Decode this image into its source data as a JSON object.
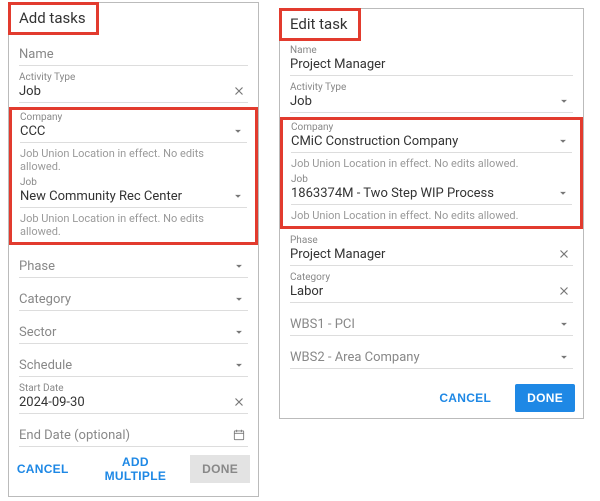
{
  "left": {
    "title": "Add tasks",
    "name": {
      "label": "Name",
      "value": ""
    },
    "activity_type": {
      "label": "Activity Type",
      "value": "Job"
    },
    "locked": {
      "company": {
        "label": "Company",
        "value": "CCC"
      },
      "msg1": "Job Union Location in effect. No edits allowed.",
      "job": {
        "label": "Job",
        "value": "New Community Rec Center"
      },
      "msg2": "Job Union Location in effect. No edits allowed."
    },
    "phase": {
      "label": "Phase"
    },
    "category": {
      "label": "Category"
    },
    "sector": {
      "label": "Sector"
    },
    "schedule": {
      "label": "Schedule"
    },
    "start_date": {
      "label": "Start Date",
      "value": "2024-09-30"
    },
    "end_date": {
      "label": "End Date (optional)"
    },
    "buttons": {
      "cancel": "CANCEL",
      "add_multiple": "ADD MULTIPLE",
      "done": "DONE"
    }
  },
  "right": {
    "title": "Edit task",
    "name": {
      "label": "Name",
      "value": "Project Manager"
    },
    "activity_type": {
      "label": "Activity Type",
      "value": "Job"
    },
    "locked": {
      "company": {
        "label": "Company",
        "value": "CMiC Construction Company"
      },
      "msg1": "Job Union Location in effect. No edits allowed.",
      "job": {
        "label": "Job",
        "value": "1863374M - Two Step WIP Process"
      },
      "msg2": "Job Union Location in effect. No edits allowed."
    },
    "phase": {
      "label": "Phase",
      "value": "Project Manager"
    },
    "category": {
      "label": "Category",
      "value": "Labor"
    },
    "wbs1": {
      "label": "WBS1 - PCI"
    },
    "wbs2": {
      "label": "WBS2 - Area Company"
    },
    "buttons": {
      "cancel": "CANCEL",
      "done": "DONE"
    }
  }
}
